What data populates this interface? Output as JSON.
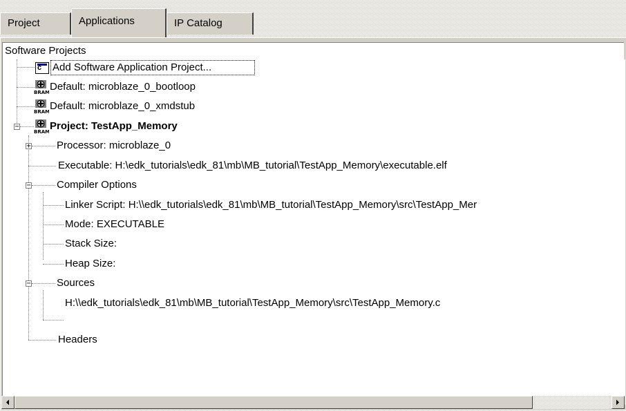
{
  "tabs": [
    {
      "label": "Project",
      "active": false
    },
    {
      "label": "Applications",
      "active": true
    },
    {
      "label": "IP Catalog",
      "active": false
    }
  ],
  "panel": {
    "title": "Software Projects"
  },
  "tree": {
    "add_app": {
      "label": "Add Software Application Project...",
      "icon": "c-file-icon"
    },
    "bootloop": {
      "label": "Default: microblaze_0_bootloop",
      "icon": "bram-icon"
    },
    "xmdstub": {
      "label": "Default: microblaze_0_xmdstub",
      "icon": "bram-icon"
    },
    "project": {
      "label": "Project: TestApp_Memory",
      "icon": "bram-icon",
      "expanded": true,
      "processor": "Processor: microblaze_0",
      "executable": "Executable: H:\\edk_tutorials\\edk_81\\mb\\MB_tutorial\\TestApp_Memory\\executable.elf",
      "compiler_options": {
        "label": "Compiler Options",
        "linker_script": "Linker Script: H:\\\\edk_tutorials\\edk_81\\mb\\MB_tutorial\\TestApp_Memory\\src\\TestApp_Mer",
        "mode": "Mode: EXECUTABLE",
        "stack_size": "Stack Size:",
        "heap_size": "Heap Size:"
      },
      "sources": {
        "label": "Sources",
        "file": "H:\\\\edk_tutorials\\edk_81\\mb\\MB_tutorial\\TestApp_Memory\\src\\TestApp_Memory.c"
      },
      "headers": "Headers"
    }
  },
  "colors": {
    "selection_border": "#000000",
    "window_face": "#d4d0c8",
    "tree_bg": "#ffffff"
  },
  "scrollbar": {
    "left_arrow": "◀",
    "right_arrow": "▶"
  }
}
